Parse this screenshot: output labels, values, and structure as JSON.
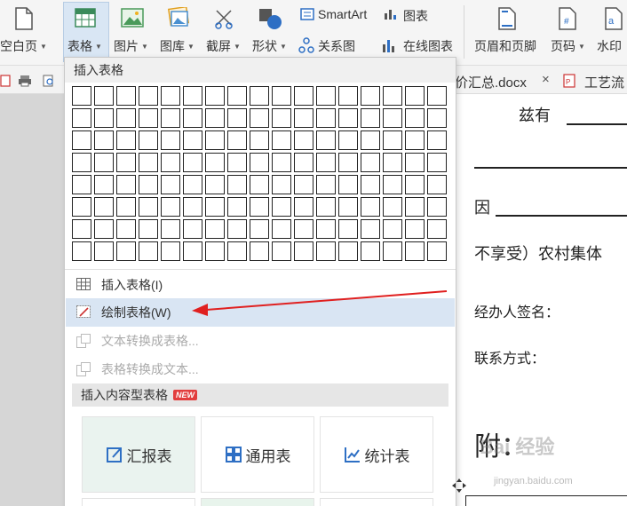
{
  "ribbon": {
    "blank_page": "空白页",
    "table": "表格",
    "picture": "图片",
    "gallery": "图库",
    "screenshot": "截屏",
    "shapes": "形状",
    "smartart": "SmartArt",
    "chart": "图表",
    "relation_chart": "关系图",
    "online_chart": "在线图表",
    "header_footer": "页眉和页脚",
    "page_number": "页码",
    "watermark": "水印"
  },
  "tabs": {
    "doc1": "价汇总.docx",
    "doc2": "工艺流"
  },
  "dropdown": {
    "header": "插入表格",
    "grid_rows": 8,
    "grid_cols": 17,
    "items": [
      {
        "label": "插入表格(I)",
        "icon": "table-insert-icon"
      },
      {
        "label": "绘制表格(W)",
        "icon": "draw-table-icon"
      },
      {
        "label": "文本转换成表格...",
        "icon": "text-to-table-icon"
      },
      {
        "label": "表格转换成文本...",
        "icon": "table-to-text-icon"
      }
    ],
    "section_header": "插入内容型表格",
    "new_badge": "NEW",
    "cards": [
      {
        "label": "汇报表",
        "icon": "report-table-icon"
      },
      {
        "label": "通用表",
        "icon": "general-table-icon"
      },
      {
        "label": "统计表",
        "icon": "statistic-table-icon"
      }
    ]
  },
  "document": {
    "line1": "兹有",
    "line3": "因",
    "line4": "不享受）农村集体",
    "line5": "经办人签名：",
    "line6": "联系方式：",
    "line7": "附："
  },
  "watermark": {
    "main": "Bai 经验",
    "sub": "jingyan.baidu.com"
  },
  "colors": {
    "accent": "#2e6fc4",
    "highlight": "#d9e5f3",
    "arrow": "#e02020"
  }
}
